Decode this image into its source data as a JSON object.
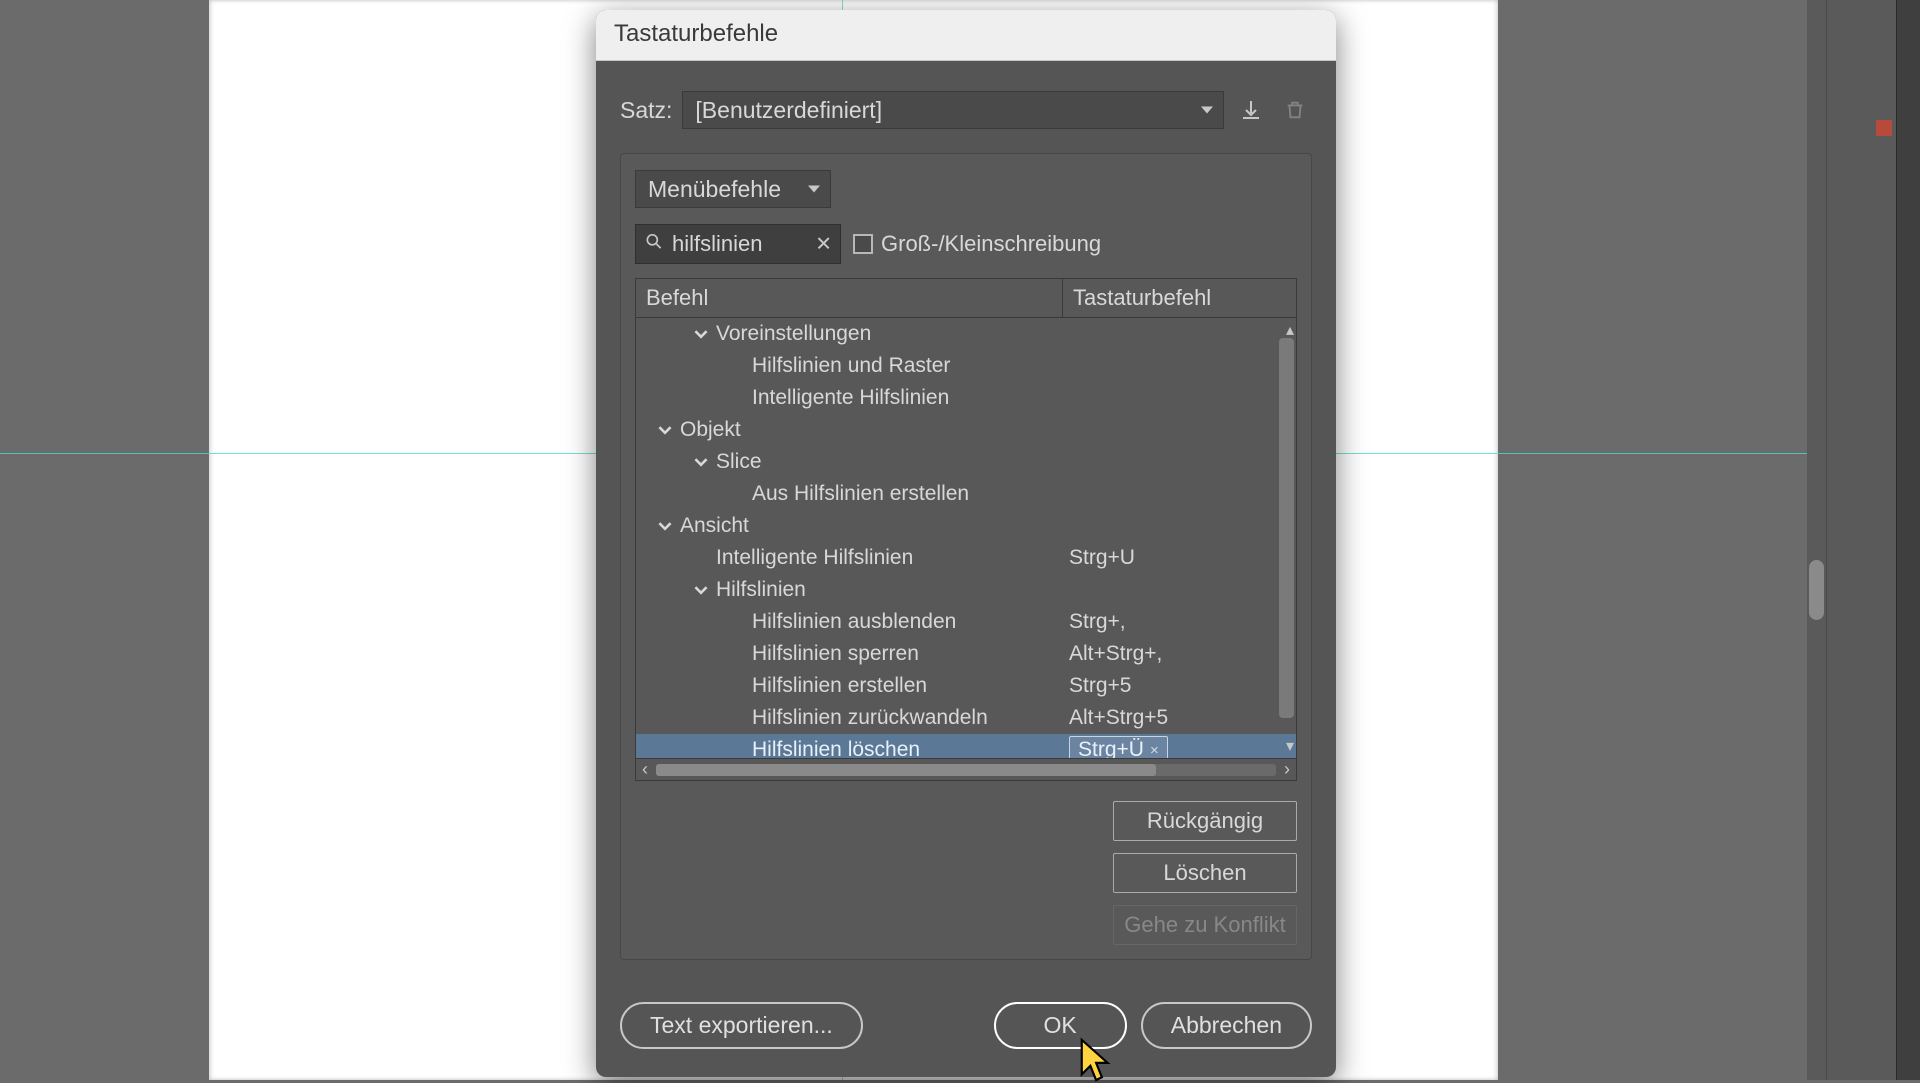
{
  "dialog": {
    "title": "Tastaturbefehle"
  },
  "set_row": {
    "label": "Satz:",
    "value": "[Benutzerdefiniert]"
  },
  "command_type": {
    "value": "Menübefehle"
  },
  "search": {
    "value": "hilfslinien",
    "case_label": "Groß-/Kleinschreibung"
  },
  "columns": {
    "command": "Befehl",
    "shortcut": "Tastaturbefehl"
  },
  "tree": [
    {
      "indent": 1,
      "expander": true,
      "label": "Voreinstellungen",
      "shortcut": ""
    },
    {
      "indent": 2,
      "expander": false,
      "label": "Hilfslinien und Raster",
      "shortcut": ""
    },
    {
      "indent": 2,
      "expander": false,
      "label": "Intelligente Hilfslinien",
      "shortcut": ""
    },
    {
      "indent": 0,
      "expander": true,
      "label": "Objekt",
      "shortcut": ""
    },
    {
      "indent": 1,
      "expander": true,
      "label": "Slice",
      "shortcut": ""
    },
    {
      "indent": 2,
      "expander": false,
      "label": "Aus Hilfslinien erstellen",
      "shortcut": ""
    },
    {
      "indent": 0,
      "expander": true,
      "label": "Ansicht",
      "shortcut": ""
    },
    {
      "indent": 1,
      "expander": false,
      "label": "Intelligente Hilfslinien",
      "shortcut": "Strg+U"
    },
    {
      "indent": 1,
      "expander": true,
      "label": "Hilfslinien",
      "shortcut": ""
    },
    {
      "indent": 2,
      "expander": false,
      "label": "Hilfslinien ausblenden",
      "shortcut": "Strg+,"
    },
    {
      "indent": 2,
      "expander": false,
      "label": "Hilfslinien sperren",
      "shortcut": "Alt+Strg+,"
    },
    {
      "indent": 2,
      "expander": false,
      "label": "Hilfslinien erstellen",
      "shortcut": "Strg+5"
    },
    {
      "indent": 2,
      "expander": false,
      "label": "Hilfslinien zurückwandeln",
      "shortcut": "Alt+Strg+5"
    },
    {
      "indent": 2,
      "expander": false,
      "label": "Hilfslinien löschen",
      "shortcut": "Strg+Ü",
      "selected": true,
      "chip": true
    }
  ],
  "side_buttons": {
    "undo": "Rückgängig",
    "delete": "Löschen",
    "goto": "Gehe zu Konflikt"
  },
  "footer": {
    "export": "Text exportieren...",
    "ok": "OK",
    "cancel": "Abbrechen"
  }
}
